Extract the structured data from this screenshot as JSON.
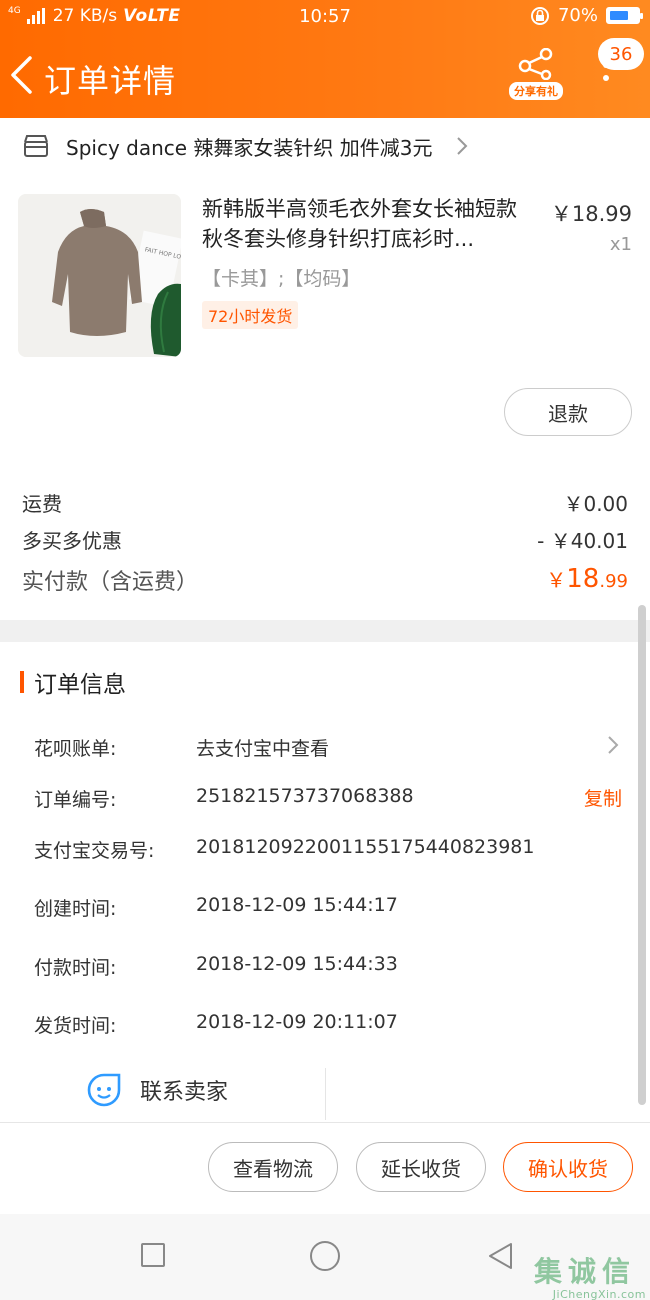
{
  "status_bar": {
    "network_type": "4G",
    "speed": "27 KB/s",
    "volte": "VoLTE",
    "time": "10:57",
    "battery": "70%",
    "battery_level": 0.7
  },
  "header": {
    "title": "订单详情",
    "share_label": "分享有礼",
    "message_count": "36"
  },
  "shop": {
    "name": "Spicy dance 辣舞家女装针织 加件减3元"
  },
  "product": {
    "title": "新韩版半高领毛衣外套女长袖短款秋冬套头修身针织打底衫时...",
    "price": "￥18.99",
    "quantity": "x1",
    "sku": "【卡其】;【均码】",
    "ship_tag": "72小时发货",
    "refund_label": "退款",
    "image_letters": "FAIT HOP LOOF"
  },
  "fees": {
    "shipping_label": "运费",
    "shipping_value": "￥0.00",
    "discount_label": "多买多优惠",
    "discount_value": "- ￥40.01",
    "total_label": "实付款（含运费）",
    "total_symbol": "￥",
    "total_int": "18",
    "total_dec": ".99"
  },
  "order_info": {
    "section_title": "订单信息",
    "rows": [
      {
        "label": "花呗账单:",
        "value": "去支付宝中查看"
      },
      {
        "label": "订单编号:",
        "value": "251821573737068388"
      },
      {
        "label": "支付宝交易号:",
        "value": "2018120922001155175440823981"
      },
      {
        "label": "创建时间:",
        "value": "2018-12-09 15:44:17"
      },
      {
        "label": "付款时间:",
        "value": "2018-12-09 15:44:33"
      },
      {
        "label": "发货时间:",
        "value": "2018-12-09 20:11:07"
      }
    ],
    "copy_label": "复制"
  },
  "contact": {
    "label": "联系卖家"
  },
  "actions": {
    "logistics": "查看物流",
    "extend": "延长收货",
    "confirm": "确认收货"
  },
  "watermark": {
    "chars": [
      "集",
      "诚",
      "信"
    ],
    "url": "JiChengXin.com"
  },
  "colors": {
    "brand_orange": "#ff6a00",
    "price_orange": "#ff5500",
    "battery_blue": "#2f8bff",
    "contact_blue": "#2f9bff"
  },
  "icons": {
    "back": "chevron-left-icon",
    "share": "share-network-icon",
    "more": "more-vertical-icon",
    "shop": "store-icon",
    "contact": "chat-face-icon"
  }
}
